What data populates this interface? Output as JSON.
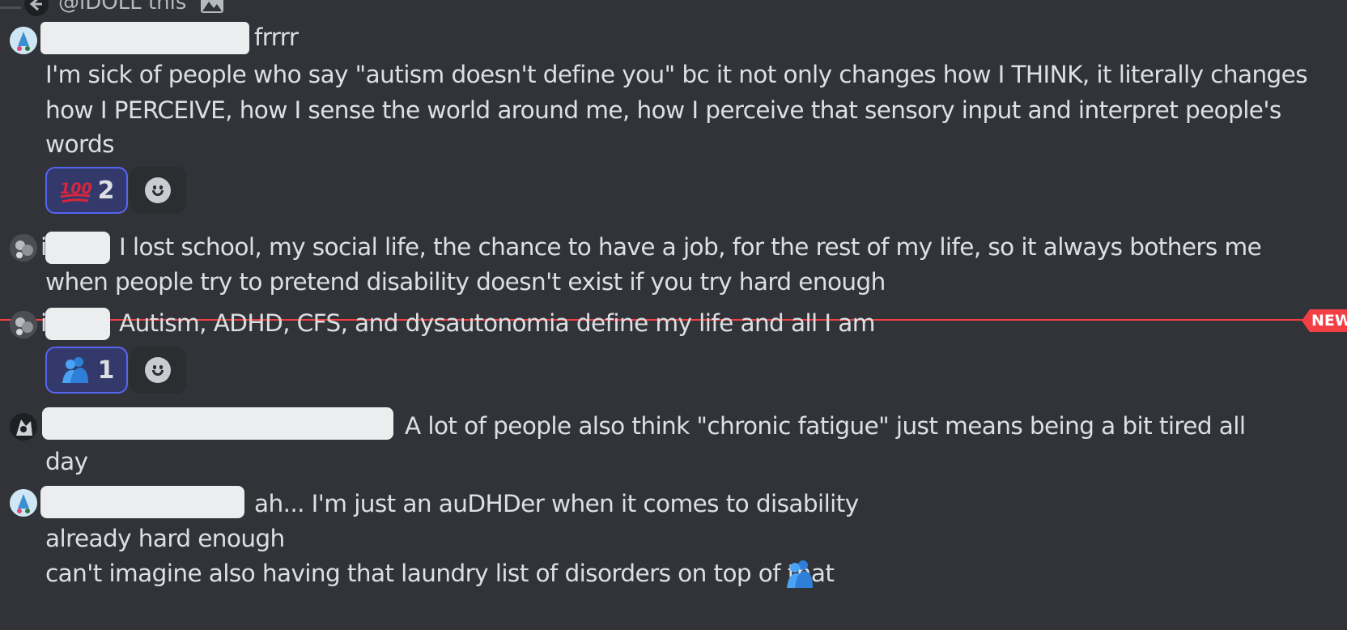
{
  "reply": {
    "text": "@iDOLL this"
  },
  "messages": [
    {
      "lead": "frrrr",
      "lines": [
        "I'm sick of people who say \"autism doesn't define you\" bc it not only changes how I THINK, it literally changes",
        "how I PERCEIVE, how I sense the world around me, how I perceive that sensory input and interpret people's",
        "words"
      ],
      "reaction": {
        "emoji": "hundred-points-icon",
        "count": "2"
      }
    },
    {
      "prefix": "i",
      "lead": "I lost school, my social life, the chance to have a job, for the rest of my life, so it always bothers me",
      "lines": [
        "when people try to pretend disability doesn't exist if you try hard enough"
      ]
    },
    {
      "prefix": "i",
      "lead": "Autism, ADHD, CFS, and dysautonomia define my life and all I am",
      "reaction": {
        "emoji": "people-hugging-icon",
        "count": "1"
      }
    },
    {
      "lead": "A lot of people also think \"chronic fatigue\" just means being a bit tired all",
      "lines": [
        "day"
      ]
    },
    {
      "lead": "ah... I'm just an auDHDer when it comes to disability",
      "lines": [
        "already hard enough",
        "can't imagine also having that laundry list of disorders on top of that"
      ]
    }
  ],
  "divider": {
    "badge": "NEW",
    "color": "#f23f43"
  },
  "colors": {
    "background": "#313338",
    "text": "#dbdee1",
    "reaction_active_border": "#5865f2"
  }
}
